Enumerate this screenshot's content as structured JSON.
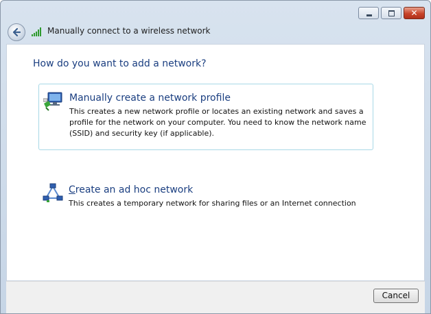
{
  "window": {
    "nav_title": "Manually connect to a wireless network",
    "controls": {
      "minimize": "",
      "maximize": "",
      "close": "✕"
    }
  },
  "main": {
    "heading": "How do you want to add a network?",
    "options": [
      {
        "title": "Manually create a network profile",
        "description": "This creates a new network profile or locates an existing network and saves a profile for the network on your computer. You need to know the network name (SSID) and security key (if applicable).",
        "icon": "network-profile-icon",
        "selected": true
      },
      {
        "title_accel": "C",
        "title_rest": "reate an ad hoc network",
        "description": "This creates a temporary network for sharing files or an Internet connection",
        "icon": "ad-hoc-network-icon",
        "selected": false
      }
    ]
  },
  "footer": {
    "cancel_label": "Cancel"
  },
  "colors": {
    "heading": "#1a3e80",
    "selection_border": "#a7d8e6",
    "close_button": "#c8442a"
  }
}
